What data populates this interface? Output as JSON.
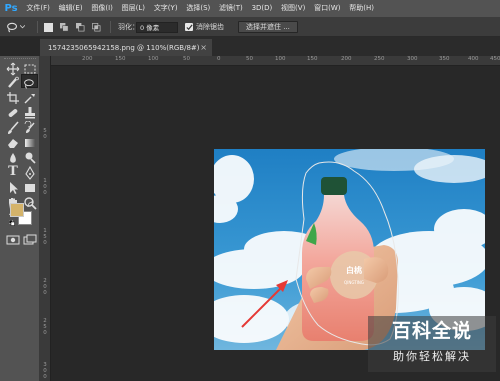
{
  "app": {
    "logo": "Ps"
  },
  "menu": [
    "文件(F)",
    "编辑(E)",
    "图像(I)",
    "图层(L)",
    "文字(Y)",
    "选择(S)",
    "滤镜(T)",
    "3D(D)",
    "视图(V)",
    "窗口(W)",
    "帮助(H)"
  ],
  "options": {
    "feather_label": "羽化：",
    "feather_value": "0 像素",
    "antialias_label": "消除锯齿",
    "antialias_checked": true,
    "select_mask_button": "选择并遮住 ..."
  },
  "document": {
    "tab_title": "1574235065942158.png @ 110%(RGB/8#)",
    "close_glyph": "×"
  },
  "ruler": {
    "horizontal": [
      "200",
      "150",
      "100",
      "50",
      "0",
      "50",
      "100",
      "150",
      "200",
      "250",
      "300",
      "350",
      "400",
      "450"
    ],
    "vertical": [
      "5",
      "0",
      "1",
      "0",
      "0",
      "1",
      "5",
      "0",
      "2",
      "0",
      "0",
      "2",
      "5",
      "0",
      "3",
      "0",
      "0"
    ]
  },
  "tools": [
    "move-icon",
    "marquee-icon",
    "lasso-icon",
    "quick-select-icon",
    "crop-icon",
    "eyedropper-icon",
    "healing-icon",
    "brush-icon",
    "clone-stamp-icon",
    "history-brush-icon",
    "eraser-icon",
    "gradient-icon",
    "blur-icon",
    "dodge-icon",
    "pen-icon",
    "type-icon",
    "path-select-icon",
    "rectangle-icon",
    "hand-icon",
    "zoom-icon",
    "more-icon"
  ],
  "colors": {
    "foreground": "#d4b36a",
    "background": "#ffffff",
    "accent": "#31a8ff",
    "arrow": "#e53935"
  },
  "watermark": {
    "title": "百科全说",
    "subtitle": "助你轻松解决"
  }
}
